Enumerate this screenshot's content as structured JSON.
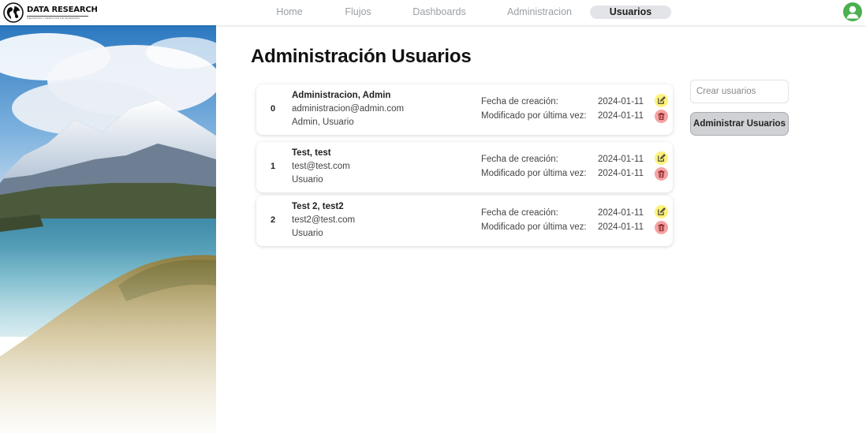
{
  "brand": {
    "name": "DATA RESEARCH",
    "tagline": "ASESORIAS Y SERVICIOS DE INGENIERIA"
  },
  "nav": {
    "items": [
      {
        "label": "Home",
        "active": false
      },
      {
        "label": "Flujos",
        "active": false
      },
      {
        "label": "Dashboards",
        "active": false
      },
      {
        "label": "Administracion",
        "active": false
      },
      {
        "label": "Usuarios",
        "active": true
      }
    ]
  },
  "user_menu": {
    "icon": "user-avatar-icon",
    "color": "#4caf50"
  },
  "page": {
    "title": "Administración Usuarios"
  },
  "card_labels": {
    "created": "Fecha de creación:",
    "modified": "Modificado por última vez:"
  },
  "users": [
    {
      "index": "0",
      "name": "Administracion, Admin",
      "email": "administracion@admin.com",
      "roles": "Admin, Usuario",
      "created": "2024-01-11",
      "modified": "2024-01-11"
    },
    {
      "index": "1",
      "name": "Test, test",
      "email": "test@test.com",
      "roles": "Usuario",
      "created": "2024-01-11",
      "modified": "2024-01-11"
    },
    {
      "index": "2",
      "name": "Test 2, test2",
      "email": "test2@test.com",
      "roles": "Usuario",
      "created": "2024-01-11",
      "modified": "2024-01-11"
    }
  ],
  "actions": {
    "create_placeholder": "Crear usuarios",
    "admin_label": "Administrar Usuarios"
  },
  "icons": {
    "edit": "edit-icon",
    "delete": "trash-icon"
  },
  "colors": {
    "edit_bg": "#fff27a",
    "delete_bg": "#f4a3a3",
    "active_tab_bg": "#e2e4e7",
    "avatar": "#4caf50"
  }
}
